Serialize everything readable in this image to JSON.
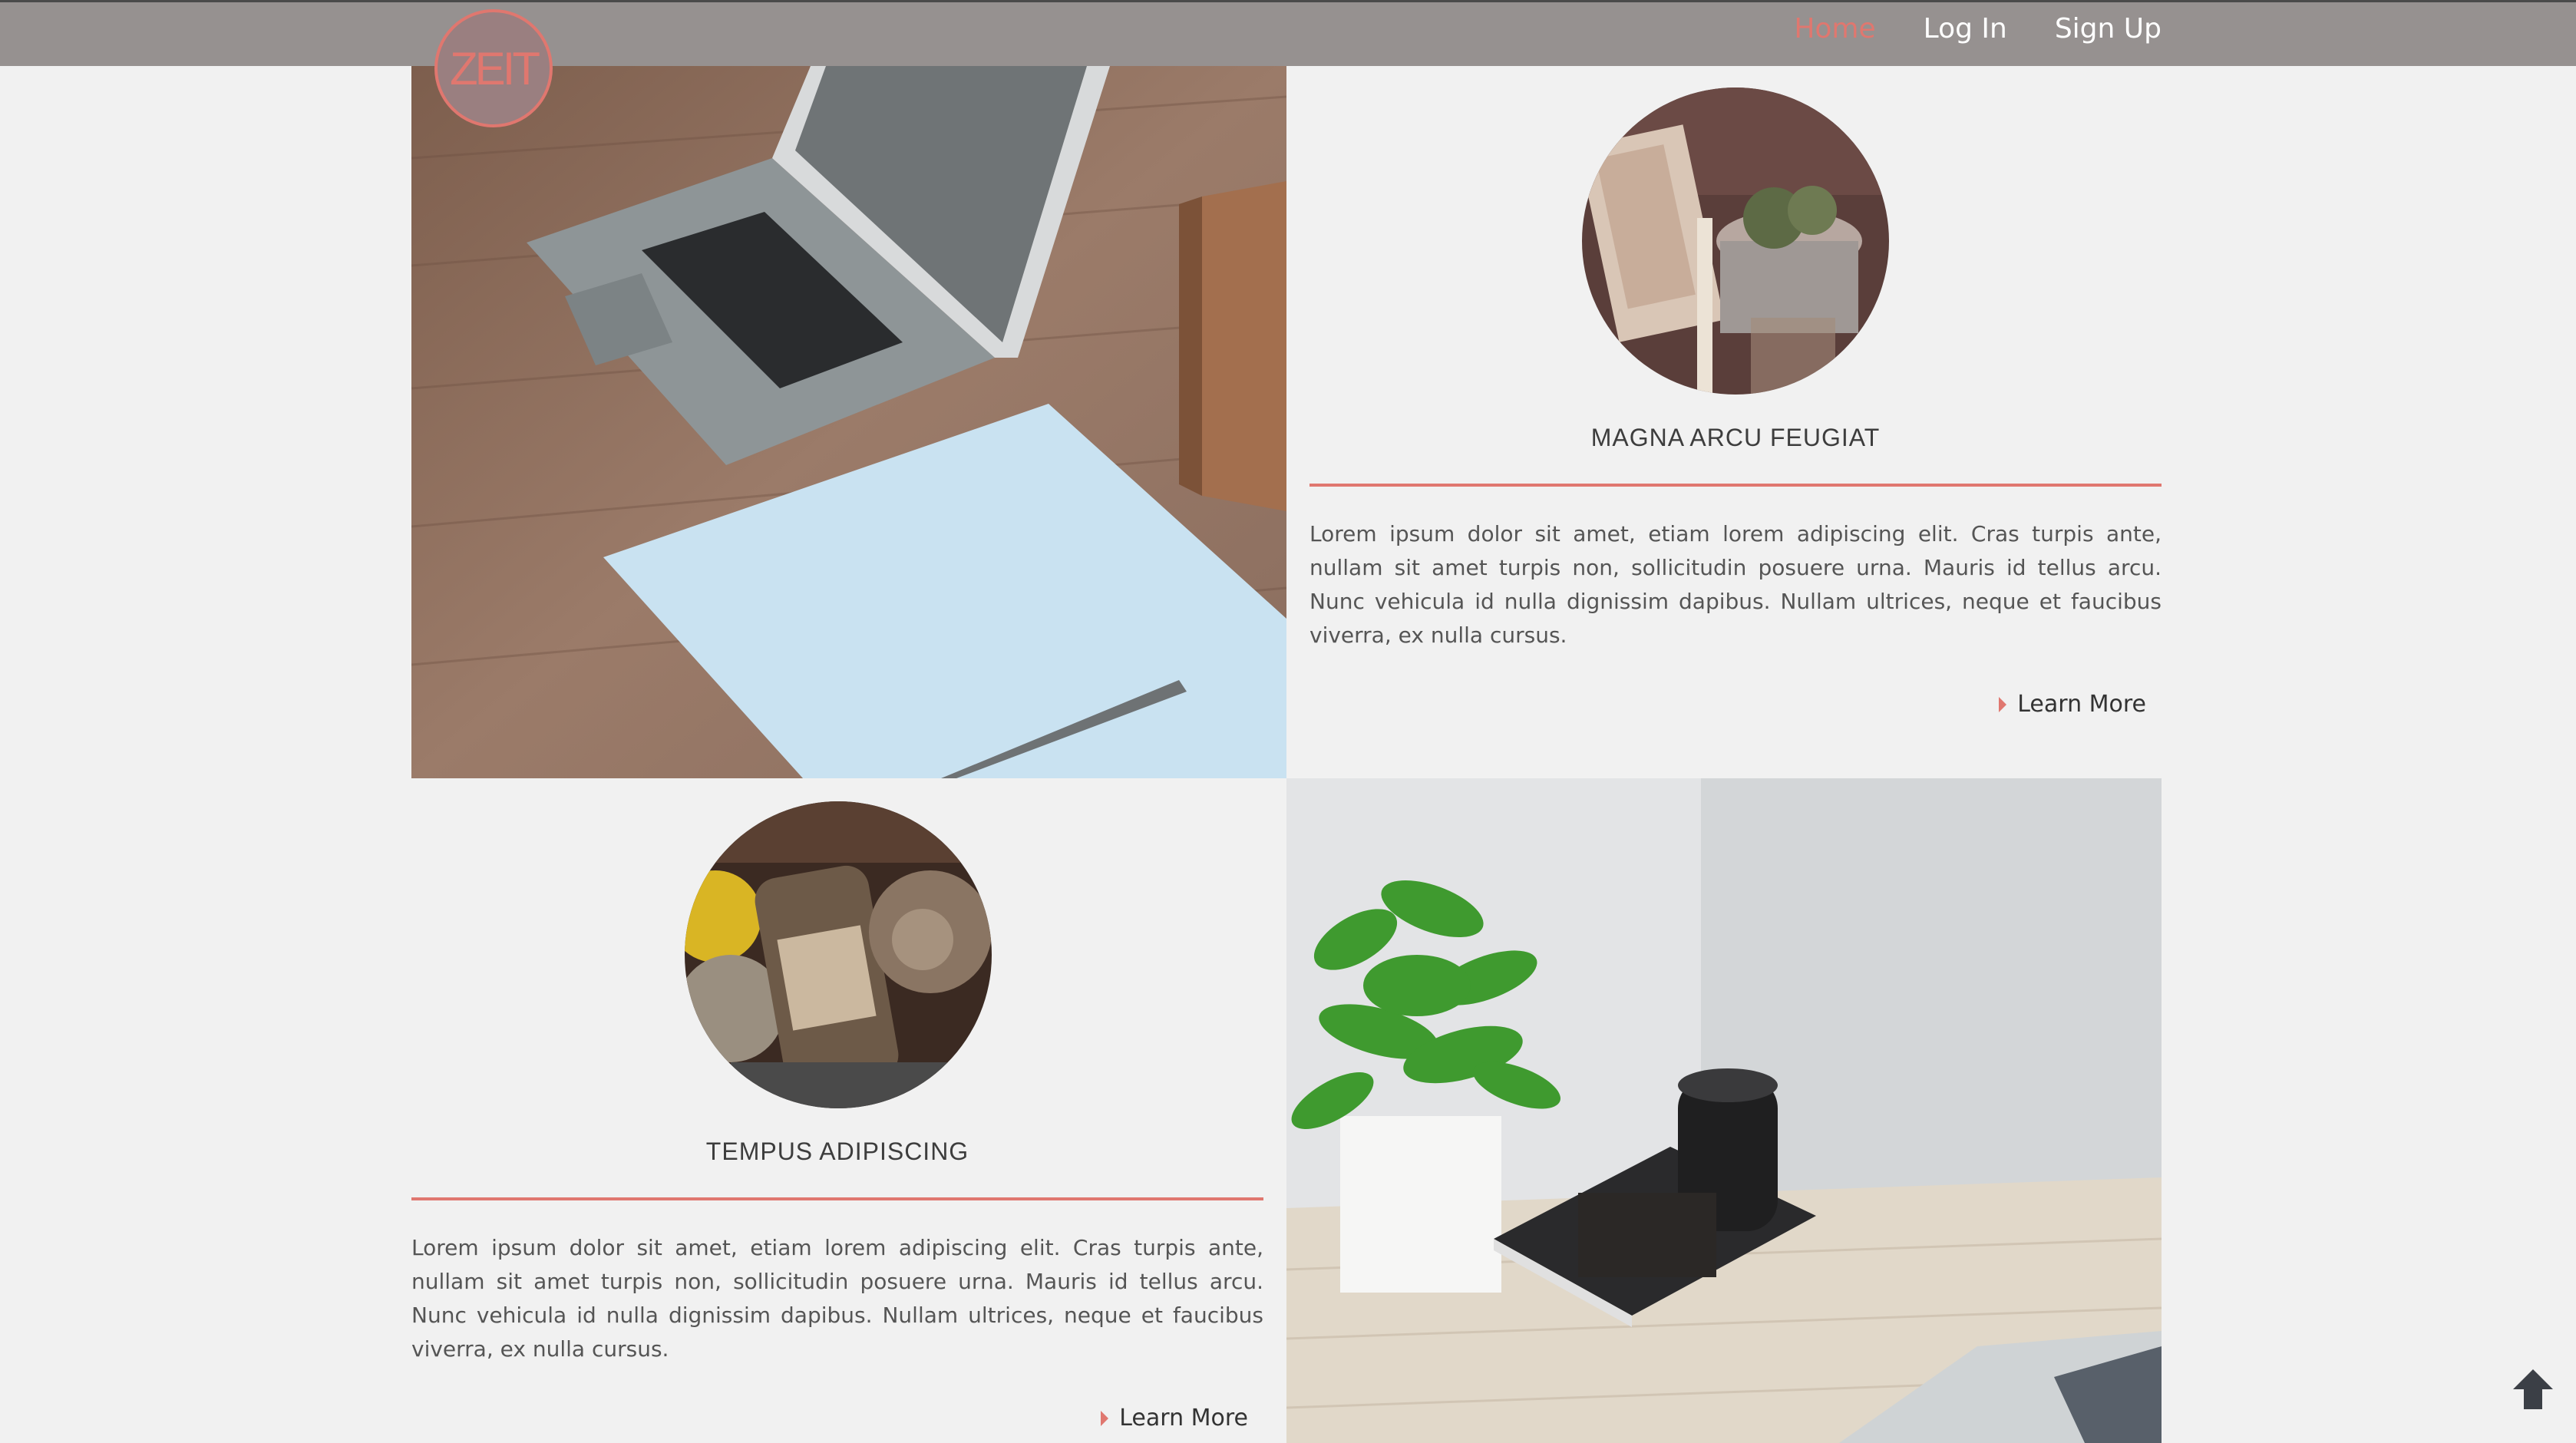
{
  "nav": {
    "logo": "ZEIT",
    "links": [
      "Home",
      "Log In",
      "Sign Up"
    ],
    "active": "Home"
  },
  "tiles": [
    {
      "title": "MAGNA ARCU FEUGIAT",
      "text": "Lorem ipsum dolor sit amet, etiam lorem adipiscing elit. Cras turpis ante, nullam sit amet turpis non, sollicitudin posuere urna. Mauris id tellus arcu. Nunc vehicula id nulla dignissim dapibus. Nullam ultrices, neque et faucibus viverra, ex nulla cursus.",
      "link": "Learn More"
    },
    {
      "title": "TEMPUS ADIPISCING",
      "text": "Lorem ipsum dolor sit amet, etiam lorem adipiscing elit. Cras turpis ante, nullam sit amet turpis non, sollicitudin posuere urna. Mauris id tellus arcu. Nunc vehicula id nulla dignissim dapibus. Nullam ultrices, neque et faucibus viverra, ex nulla cursus.",
      "link": "Learn More"
    }
  ],
  "colors": {
    "accent": "#e0776f",
    "navbar": "#969190",
    "background": "#f1f1f1"
  },
  "icons": [
    "arrow-up-icon"
  ]
}
